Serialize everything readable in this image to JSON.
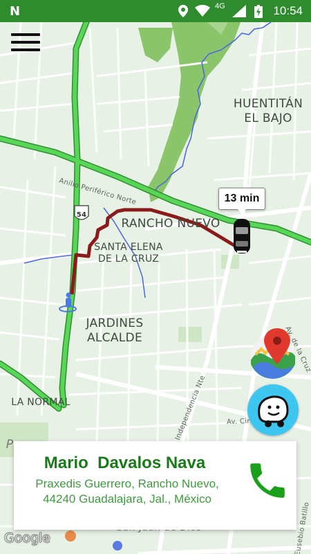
{
  "status_bar": {
    "app_glyph": "N",
    "network": "4G",
    "time": "10:54",
    "icons": [
      "location-pin-icon",
      "wifi-icon",
      "signal-icon",
      "battery-charging-icon"
    ]
  },
  "map": {
    "labels": {
      "huentitan": "HUENTITÁN\nEL BAJO",
      "rancho_nuevo": "RANCHO NUEVO",
      "santa_elena": "SANTA ELENA\nDE LA CRUZ",
      "jardines": "JARDINES\nALCALDE",
      "la_normal": "LA NORMAL",
      "anillo": "Anillo Periférico Norte",
      "shield": "54",
      "indep": "Calz. Independencia Nte",
      "circunv": "Av. Circunv.",
      "av_la_cruz": "Av. de la Cruz",
      "batillo": "Calle Eusebio Batillo",
      "bottom_left": "P",
      "san_juan": "San Juan de Dios"
    },
    "eta": "13 min",
    "attribution": "Google",
    "route_color": "#8b1a1a",
    "highway_color": "#4cd04c"
  },
  "menu": {
    "icon": "hamburger-menu-icon"
  },
  "fabs": {
    "maps": "google-maps-icon",
    "waze": "waze-icon"
  },
  "contact": {
    "name": "Mario  Davalos Nava",
    "address": "Praxedis Guerrero, Rancho Nuevo,\n44240 Guadalajara, Jal., México",
    "call_icon": "phone-icon"
  }
}
